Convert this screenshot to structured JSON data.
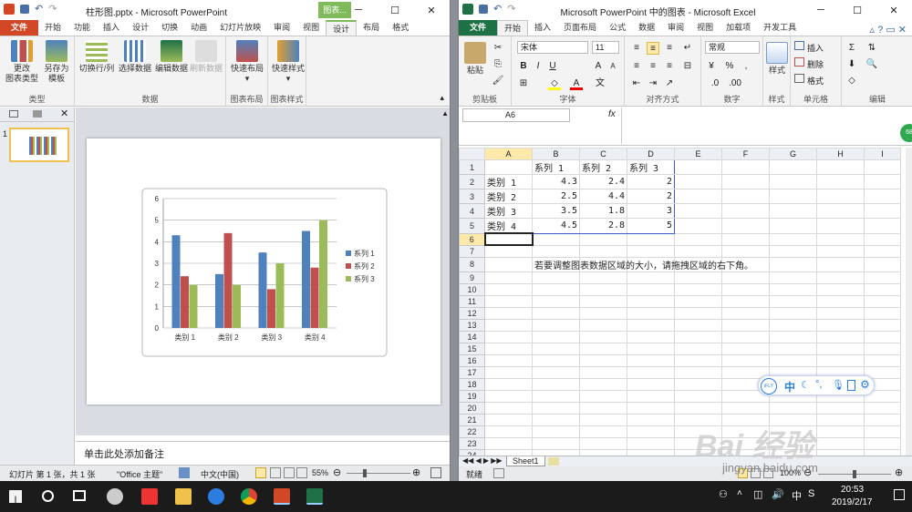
{
  "ppt": {
    "title": "柱形图.pptx - Microsoft PowerPoint",
    "context_tab": "图表...",
    "tabs": [
      "文件",
      "开始",
      "功能",
      "插入",
      "设计",
      "切换",
      "动画",
      "幻灯片放映",
      "审阅",
      "视图",
      "设计",
      "布局",
      "格式"
    ],
    "ribbon_buttons": [
      "更改\n图表类型",
      "另存为\n模板",
      "切换行/列",
      "选择数据",
      "编辑数据",
      "刷新数据",
      "快速布局",
      "快速样式"
    ],
    "groups": [
      "类型",
      "数据",
      "图表布局",
      "图表样式"
    ],
    "slide_number": "1",
    "notes_placeholder": "单击此处添加备注",
    "status": {
      "slide_info": "幻灯片 第 1 张，共 1 张",
      "theme": "\"Office 主题\"",
      "lang": "中文(中国)",
      "zoom": "55%"
    }
  },
  "chart_data": {
    "type": "bar",
    "categories": [
      "类别 1",
      "类别 2",
      "类别 3",
      "类别 4"
    ],
    "series": [
      {
        "name": "系列 1",
        "values": [
          4.3,
          2.5,
          3.5,
          4.5
        ]
      },
      {
        "name": "系列 2",
        "values": [
          2.4,
          4.4,
          1.8,
          2.8
        ]
      },
      {
        "name": "系列 3",
        "values": [
          2,
          2,
          3,
          5
        ]
      }
    ],
    "ylim": [
      0,
      6
    ],
    "yticks": [
      "0",
      "1",
      "2",
      "3",
      "4",
      "5",
      "6"
    ],
    "colors": [
      "#4f81bd",
      "#c0504d",
      "#9bbb59"
    ],
    "legend": "right",
    "grid": true
  },
  "xl": {
    "title": "Microsoft PowerPoint 中的图表 - Microsoft Excel",
    "tabs": [
      "文件",
      "开始",
      "插入",
      "页面布局",
      "公式",
      "数据",
      "审阅",
      "视图",
      "加载项",
      "开发工具"
    ],
    "font_name": "宋体",
    "font_size": "11",
    "number_format": "常规",
    "groups": [
      "剪贴板",
      "字体",
      "对齐方式",
      "数字",
      "样式",
      "单元格",
      "编辑"
    ],
    "paste_label": "粘贴",
    "style_label": "样式",
    "cell_btns": [
      "插入",
      "删除",
      "格式"
    ],
    "name_box": "A6",
    "fx": "fx",
    "columns": [
      "A",
      "B",
      "C",
      "D",
      "E",
      "F",
      "G",
      "H",
      "I"
    ],
    "rows": [
      [
        "",
        "系列 1",
        "系列 2",
        "系列 3"
      ],
      [
        "类别 1",
        "4.3",
        "2.4",
        "2"
      ],
      [
        "类别 2",
        "2.5",
        "4.4",
        "2"
      ],
      [
        "类别 3",
        "3.5",
        "1.8",
        "3"
      ],
      [
        "类别 4",
        "4.5",
        "2.8",
        "5"
      ],
      [
        "",
        "",
        "",
        ""
      ],
      [
        "",
        "",
        "",
        ""
      ],
      [
        "",
        "若要调整图表数据区域的大小，请拖拽区域的右下角。",
        "",
        ""
      ]
    ],
    "total_rows": 25,
    "sheet_tab": "Sheet1",
    "status_ready": "就绪",
    "zoom": "100%",
    "ime": "中"
  },
  "taskbar": {
    "time": "20:53",
    "date": "2019/2/17"
  },
  "watermark": {
    "text": "Bai 经验",
    "url": "jingyan.baidu.com"
  }
}
